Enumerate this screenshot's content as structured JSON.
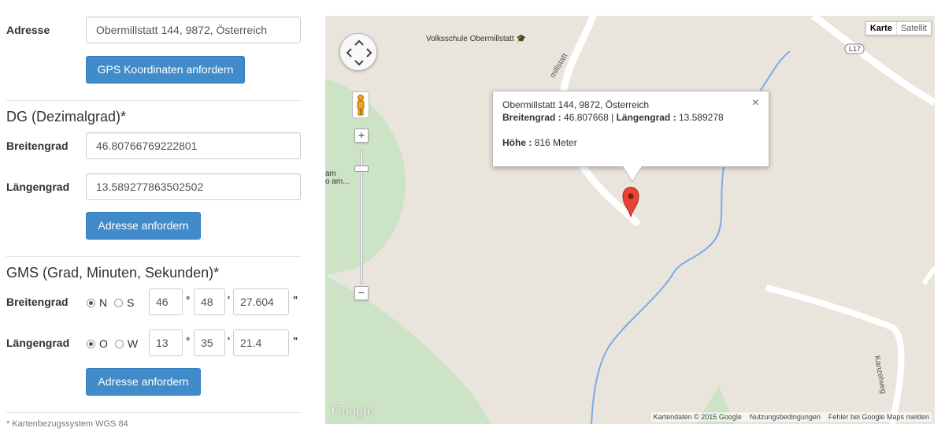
{
  "address_section": {
    "label": "Adresse",
    "value": "Obermillstatt 144, 9872, Österreich",
    "button": "GPS Koordinaten anfordern"
  },
  "dg_section": {
    "title": "DG (Dezimalgrad)*",
    "lat_label": "Breitengrad",
    "lat_value": "46.80766769222801",
    "lng_label": "Längengrad",
    "lng_value": "13.589277863502502",
    "button": "Adresse anfordern"
  },
  "gms_section": {
    "title": "GMS (Grad, Minuten, Sekunden)*",
    "lat": {
      "label": "Breitengrad",
      "opt1": "N",
      "opt2": "S",
      "selected": "N",
      "deg": "46",
      "min": "48",
      "sec": "27.604"
    },
    "lng": {
      "label": "Längengrad",
      "opt1": "O",
      "opt2": "W",
      "selected": "O",
      "deg": "13",
      "min": "35",
      "sec": "21.4"
    },
    "deg_unit": "°",
    "min_unit": "'",
    "sec_unit": "\"",
    "button": "Adresse anfordern"
  },
  "footnote": "* Kartenbezugssystem WGS 84",
  "map": {
    "type_buttons": [
      "Karte",
      "Satellit"
    ],
    "active_type": "Karte",
    "labels": {
      "school": "Volksschule Obermillstatt",
      "street_top": "millstatt",
      "road_badge": "L17",
      "left_cut_1": "am",
      "left_cut_2": "o am...",
      "kanzelweg": "Kanzelweg"
    },
    "infowindow": {
      "address": "Obermillstatt 144, 9872, Österreich",
      "lat_label": "Breitengrad :",
      "lat_value": "46.807668",
      "separator": "|",
      "lng_label": "Längengrad :",
      "lng_value": "13.589278",
      "height_label": "Höhe :",
      "height_value": "816 Meter",
      "close": "×"
    },
    "zoom_in": "+",
    "zoom_out": "−",
    "logo": "Google",
    "attribution": [
      "Kartendaten © 2015 Google",
      "Nutzungsbedingungen",
      "Fehler bei Google Maps melden"
    ],
    "colors": {
      "land": "#e9e5dc",
      "park": "#cde3c5",
      "water": "#7fa8e6",
      "road": "#ffffff"
    }
  }
}
